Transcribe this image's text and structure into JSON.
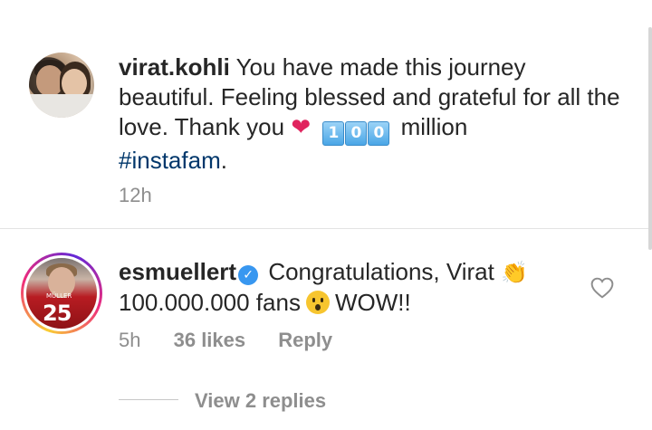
{
  "post_caption": {
    "username": "virat.kohli",
    "text_before_heart": "You have made this journey beautiful. Feeling blessed and grateful for all the love. Thank you",
    "heart_emoji": "❤",
    "keycaps": [
      "1",
      "0",
      "0"
    ],
    "text_after_keycaps": "million",
    "hashtag": "#instafam",
    "trailing": ".",
    "time": "12h"
  },
  "comment": {
    "username": "esmuellert",
    "verified_glyph": "✓",
    "text_line1": "Congratulations, Virat",
    "clap_emoji": "👏",
    "text_line2_before": "100.000.000 fans",
    "text_line2_after": "WOW!!",
    "time": "5h",
    "likes": "36 likes",
    "reply_label": "Reply",
    "avatar_number": "25",
    "avatar_name": "MÜLLER",
    "view_replies": "View 2 replies"
  },
  "colors": {
    "text": "#262626",
    "meta": "#8e8e8e",
    "link": "#00376b",
    "heart": "#e0245e",
    "verified": "#3897f0"
  }
}
